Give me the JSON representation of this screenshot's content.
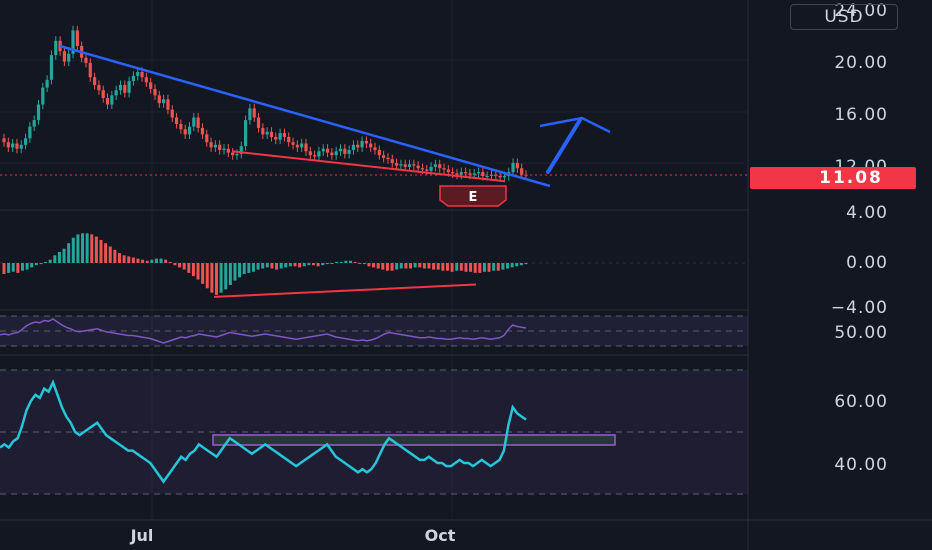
{
  "currency": "USD",
  "last_price": "11.08",
  "earnings_badge": "E",
  "price_axis": {
    "ticks": [
      {
        "label": "24.00",
        "value": 24
      },
      {
        "label": "20.00",
        "value": 20
      },
      {
        "label": "16.00",
        "value": 16
      },
      {
        "label": "12.00",
        "value": 12
      },
      {
        "label": "4.00",
        "value": 4
      }
    ]
  },
  "macd_axis": {
    "ticks": [
      {
        "label": "0.00",
        "value": 0
      },
      {
        "label": "−4.00",
        "value": -4
      }
    ]
  },
  "rsi_small_axis": {
    "ticks": [
      {
        "label": "50.00",
        "value": 50
      }
    ]
  },
  "rsi_axis": {
    "ticks": [
      {
        "label": "60.00",
        "value": 60
      },
      {
        "label": "40.00",
        "value": 40
      }
    ]
  },
  "time_axis": {
    "labels": [
      "Jul",
      "Oct"
    ]
  },
  "colors": {
    "background": "#131722",
    "up": "#26a69a",
    "down": "#ef5350",
    "trendline_blue": "#2962ff",
    "support_red": "#f23645",
    "rsi_purple": "#7e57c2",
    "rsi_cyan": "#26c6da",
    "last_price_tag": "#f23645"
  },
  "chart_data": [
    {
      "type": "candlestick",
      "title": "",
      "x_range": [
        "June",
        "October"
      ],
      "ylim": [
        9,
        24
      ],
      "close_series": [
        13.6,
        13.2,
        13.5,
        13.1,
        13.4,
        13.9,
        14.8,
        15.3,
        16.5,
        17.8,
        18.4,
        20.3,
        21.4,
        20.6,
        19.8,
        20.4,
        22.2,
        21.0,
        20.1,
        19.7,
        18.6,
        18.0,
        17.6,
        17.0,
        16.5,
        17.2,
        17.6,
        18.0,
        17.4,
        18.3,
        18.7,
        19.0,
        18.6,
        18.2,
        17.7,
        17.2,
        16.6,
        16.9,
        16.1,
        15.5,
        15.0,
        14.6,
        14.2,
        14.8,
        15.5,
        14.7,
        14.2,
        13.6,
        13.2,
        13.4,
        13.0,
        13.1,
        12.8,
        12.6,
        12.7,
        13.3,
        15.3,
        16.2,
        15.5,
        14.7,
        14.2,
        14.4,
        14.0,
        13.8,
        14.3,
        14.0,
        13.6,
        13.4,
        13.2,
        13.5,
        12.9,
        12.6,
        12.5,
        12.9,
        13.1,
        12.8,
        12.6,
        12.9,
        13.1,
        12.7,
        13.0,
        13.4,
        13.2,
        13.7,
        13.5,
        13.2,
        13.0,
        12.6,
        12.4,
        12.3,
        12.0,
        11.8,
        11.9,
        11.7,
        11.9,
        11.8,
        11.6,
        11.5,
        11.4,
        11.7,
        11.9,
        11.6,
        11.5,
        11.3,
        11.2,
        11.1,
        11.3,
        11.2,
        11.1,
        11.2,
        11.3,
        11.0,
        11.0,
        11.1,
        11.0,
        10.9,
        11.0,
        11.3,
        12.0,
        11.6,
        11.1,
        11.08
      ],
      "trendlines": [
        {
          "name": "descending resistance",
          "start": 21.0,
          "end": 11.0
        },
        {
          "name": "lower support",
          "start": 12.9,
          "end": 10.6
        }
      ]
    },
    {
      "type": "bar",
      "title": "",
      "ylim": [
        -4,
        4
      ],
      "values": [
        -1.0,
        -0.9,
        -0.8,
        -0.9,
        -0.7,
        -0.6,
        -0.4,
        -0.2,
        -0.1,
        0.1,
        0.3,
        0.7,
        1.0,
        1.3,
        1.8,
        2.3,
        2.6,
        2.7,
        2.7,
        2.6,
        2.4,
        2.1,
        1.8,
        1.5,
        1.2,
        0.9,
        0.7,
        0.6,
        0.5,
        0.4,
        0.3,
        0.2,
        0.3,
        0.4,
        0.4,
        0.3,
        0.1,
        -0.2,
        -0.4,
        -0.6,
        -0.9,
        -1.2,
        -1.5,
        -1.9,
        -2.3,
        -2.7,
        -2.9,
        -2.7,
        -2.4,
        -2.0,
        -1.6,
        -1.3,
        -1.0,
        -0.9,
        -0.8,
        -0.6,
        -0.5,
        -0.4,
        -0.5,
        -0.6,
        -0.5,
        -0.4,
        -0.3,
        -0.3,
        -0.4,
        -0.3,
        -0.2,
        -0.2,
        -0.3,
        -0.2,
        -0.1,
        0.0,
        0.1,
        0.1,
        0.2,
        0.2,
        0.1,
        0.0,
        -0.1,
        -0.3,
        -0.4,
        -0.5,
        -0.6,
        -0.7,
        -0.7,
        -0.6,
        -0.5,
        -0.5,
        -0.5,
        -0.4,
        -0.4,
        -0.5,
        -0.5,
        -0.6,
        -0.6,
        -0.7,
        -0.7,
        -0.8,
        -0.7,
        -0.7,
        -0.8,
        -0.8,
        -0.9,
        -0.9,
        -0.8,
        -0.8,
        -0.7,
        -0.7,
        -0.6,
        -0.5,
        -0.4,
        -0.3,
        -0.2,
        -0.1
      ],
      "divergence_line": {
        "start": -2.9,
        "end": -1.5
      }
    },
    {
      "type": "line",
      "title": "",
      "ylim": [
        30,
        70
      ],
      "values": [
        45,
        46,
        45,
        47,
        48,
        52,
        57,
        60,
        62,
        61,
        64,
        63,
        66,
        62,
        58,
        55,
        53,
        50,
        49,
        50,
        51,
        52,
        53,
        51,
        49,
        48,
        47,
        46,
        45,
        44,
        44,
        43,
        42,
        41,
        40,
        38,
        36,
        34,
        36,
        38,
        40,
        42,
        41,
        43,
        44,
        46,
        45,
        44,
        43,
        42,
        44,
        46,
        48,
        47,
        46,
        45,
        44,
        43,
        44,
        45,
        46,
        45,
        44,
        43,
        42,
        41,
        40,
        39,
        40,
        41,
        42,
        43,
        44,
        45,
        46,
        44,
        42,
        41,
        40,
        39,
        38,
        37,
        38,
        37,
        38,
        40,
        43,
        46,
        48,
        47,
        46,
        45,
        44,
        43,
        42,
        41,
        41,
        42,
        41,
        40,
        40,
        39,
        39,
        40,
        41,
        40,
        40,
        39,
        40,
        41,
        40,
        39,
        40,
        41,
        44,
        52,
        58,
        56,
        55,
        54
      ],
      "bands": [
        30,
        50,
        70
      ],
      "highlight_level": 47
    }
  ]
}
